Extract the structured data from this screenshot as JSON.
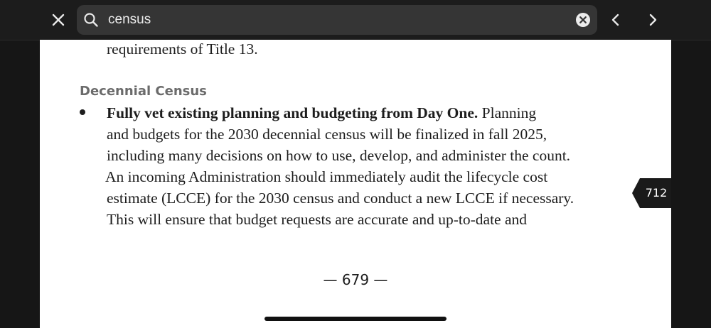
{
  "search": {
    "query": "census"
  },
  "icons": {
    "close": "close-icon",
    "search": "search-icon",
    "clear": "clear-circle-icon",
    "prev": "chevron-left-icon",
    "next": "chevron-right-icon"
  },
  "page": {
    "top_line": "requirements of Title 13.",
    "section_heading": "Decennial Census",
    "bullet": {
      "bold_lead": "Fully vet existing planning and budgeting from Day One.",
      "line1_rest": " Planning",
      "line2": "and budgets for the 2030 decennial census will be finalized in fall 2025,",
      "line3": "including many decisions on how to use, develop, and administer the count.",
      "line4": "An incoming Administration should immediately audit the lifecycle cost",
      "line5": "estimate (LCCE) for the 2030 census and conduct a new LCCE if necessary.",
      "line6": "This will ensure that budget requests are accurate and up-to-date and"
    },
    "page_number": "— 679 —"
  },
  "badge": {
    "value": "712"
  },
  "colors": {
    "toolbar_bg": "#1c1c1c",
    "search_bg": "#353535",
    "page_bg": "#ffffff",
    "heading_gray": "#6b6b6b",
    "badge_bg": "#1a1a1a"
  }
}
